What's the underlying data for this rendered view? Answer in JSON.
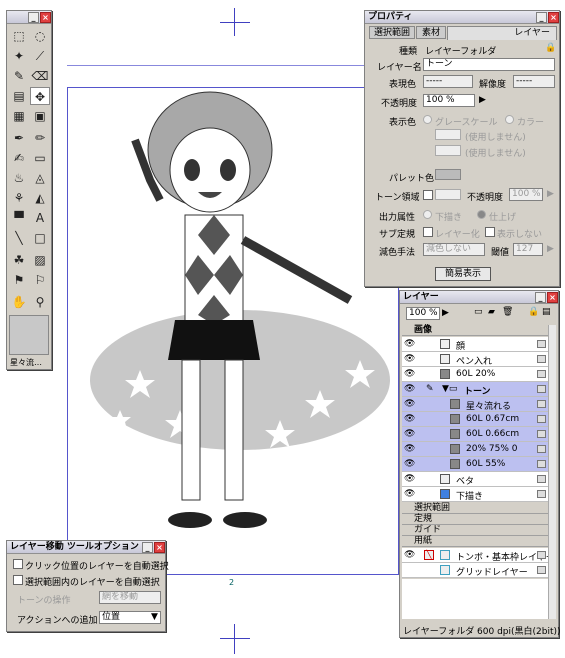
{
  "tools_window": {
    "preset_label": "星々流…"
  },
  "property_window": {
    "title": "プロパティ",
    "tabs": [
      "選択範囲",
      "素材",
      "レイヤー"
    ],
    "kind_label": "種類",
    "kind_value": "レイヤーフォルダ",
    "name_label": "レイヤー名",
    "name_value": "トーン",
    "display_color_label": "表現色",
    "display_color_value": "-----",
    "resolution_label": "解像度",
    "resolution_value": "-----",
    "opacity_label": "不透明度",
    "opacity_value": "100 %",
    "color_label": "表示色",
    "grayscale": "グレースケール",
    "color_option": "カラー",
    "unused1": "(使用しません)",
    "unused2": "(使用しません)",
    "palette_label": "パレット色",
    "tone_area_label": "トーン領域",
    "tone_opacity_label": "不透明度",
    "tone_opacity_value": "100 %",
    "output_label": "出力属性",
    "output_draft": "下描き",
    "output_finish": "仕上げ",
    "sub_label": "サブ定規",
    "sub_layerize": "レイヤー化",
    "sub_hide": "表示しない",
    "reduce_label": "減色手法",
    "reduce_value": "減色しない",
    "threshold_label": "閾値",
    "threshold_value": "127",
    "simple_button": "簡易表示"
  },
  "layer_window": {
    "title": "レイヤー",
    "opacity": "100 %",
    "groups": {
      "image": "画像",
      "selection": "選択範囲",
      "ruler": "定規",
      "guide": "ガイド",
      "paper": "用紙"
    },
    "layers": [
      {
        "name": "顔"
      },
      {
        "name": "ペン入れ"
      },
      {
        "name": "60L 20%"
      },
      {
        "name": "トーン"
      },
      {
        "name": "星々流れる"
      },
      {
        "name": "60L 0.67cm"
      },
      {
        "name": "60L 0.66cm"
      },
      {
        "name": "20% 75% 0"
      },
      {
        "name": "60L 55%"
      },
      {
        "name": "ベタ"
      },
      {
        "name": "下描き"
      },
      {
        "name": "トンボ・基本枠レイヤー"
      },
      {
        "name": "グリッドレイヤー"
      }
    ],
    "status": "レイヤーフォルダ 600 dpi(黒白(2bit))"
  },
  "tool_option_window": {
    "title": "レイヤー移動 ツールオプション",
    "auto_select_click": "クリック位置のレイヤーを自動選択",
    "auto_select_sel": "選択範囲内のレイヤーを自動選択",
    "tone_op_label": "トーンの操作",
    "tone_op_value": "網を移動",
    "action_label": "アクションへの追加",
    "action_value": "位置"
  },
  "canvas": {
    "page_number": "2"
  }
}
